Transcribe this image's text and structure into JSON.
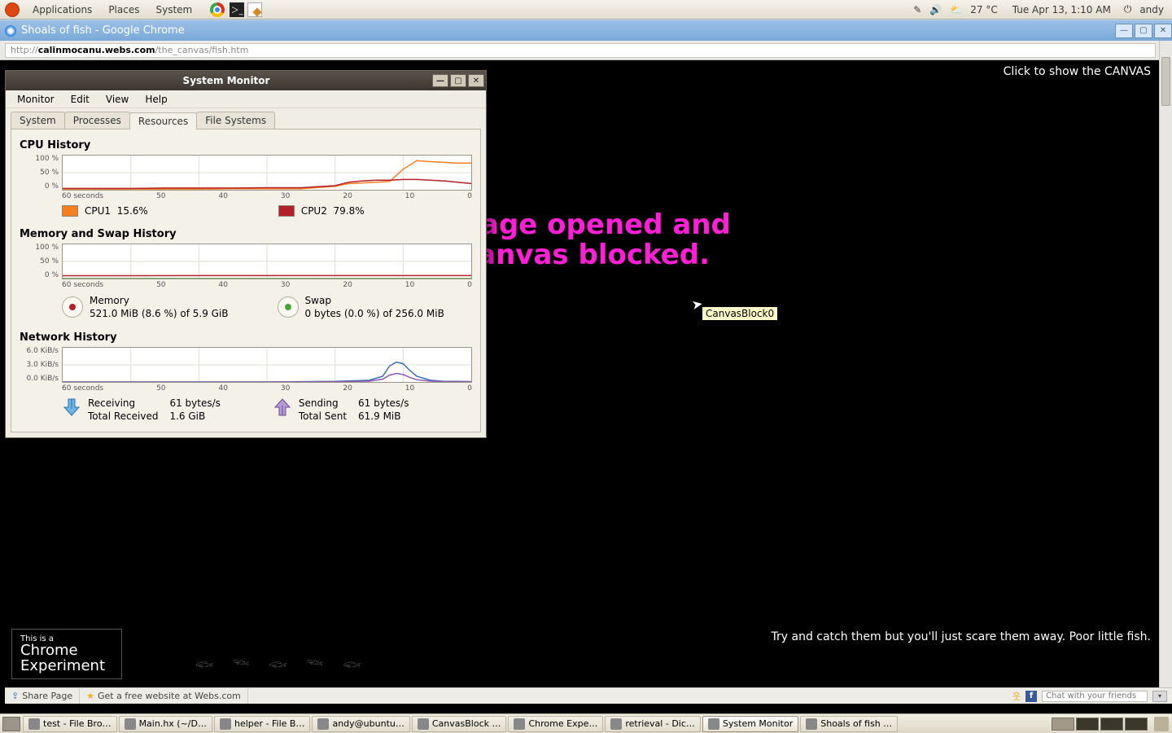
{
  "top_panel": {
    "menus": [
      "Applications",
      "Places",
      "System"
    ],
    "temp": "27 °C",
    "datetime": "Tue Apr 13,  1:10 AM",
    "user": "andy"
  },
  "chrome": {
    "title": "Shoals of fish - Google Chrome",
    "url_prefix": "http://",
    "url_host": "calinmocanu.webs.com",
    "url_path": "/the_canvas/fish.htm"
  },
  "page": {
    "top_link": "Click to show the CANVAS",
    "caption": "Try and catch them but you'll just scare them away. Poor little fish.",
    "exp_small": "This is a",
    "exp_line1": "Chrome",
    "exp_line2": "Experiment",
    "tooltip": "CanvasBlock0"
  },
  "webs_bar": {
    "share": "Share Page",
    "getsite": "Get a free website at Webs.com",
    "chat_placeholder": "Chat with your friends"
  },
  "sysmon": {
    "title": "System Monitor",
    "menus": [
      "Monitor",
      "Edit",
      "View",
      "Help"
    ],
    "tabs": [
      "System",
      "Processes",
      "Resources",
      "File Systems"
    ],
    "active_tab": 2,
    "cpu_title": "CPU History",
    "mem_title": "Memory and Swap History",
    "net_title": "Network History",
    "x_ticks": [
      "60 seconds",
      "50",
      "40",
      "30",
      "20",
      "10",
      "0"
    ],
    "cpu_y": [
      "100 %",
      "50 %",
      "0 %"
    ],
    "mem_y": [
      "100 %",
      "50 %",
      "0 %"
    ],
    "net_y": [
      "6.0 KiB/s",
      "3.0 KiB/s",
      "0.0 KiB/s"
    ],
    "cpu_legend": [
      {
        "label": "CPU1",
        "value": "15.6%",
        "color": "#f57e20"
      },
      {
        "label": "CPU2",
        "value": "79.8%",
        "color": "#b3202a"
      }
    ],
    "mem_legend": {
      "mem_label": "Memory",
      "mem_detail": "521.0 MiB (8.6 %) of 5.9 GiB",
      "swap_label": "Swap",
      "swap_detail": "0 bytes (0.0 %) of 256.0 MiB"
    },
    "net_legend": {
      "recv_label": "Receiving",
      "recv_rate": "61 bytes/s",
      "recv_total_label": "Total Received",
      "recv_total": "1.6 GiB",
      "send_label": "Sending",
      "send_rate": "61 bytes/s",
      "send_total_label": "Total Sent",
      "send_total": "61.9 MiB"
    }
  },
  "annotation": {
    "text": "Page opened and\ncanvas blocked."
  },
  "taskbar": {
    "items": [
      "test - File Bro…",
      "Main.hx (~/D…",
      "helper - File B…",
      "andy@ubuntu…",
      "CanvasBlock …",
      "Chrome Expe…",
      "retrieval - Dic…",
      "System Monitor",
      "Shoals of fish …"
    ],
    "active": 7
  },
  "chart_data": [
    {
      "type": "line",
      "title": "CPU History",
      "xlabel": "seconds ago",
      "ylabel": "%",
      "x": [
        60,
        55,
        50,
        45,
        40,
        35,
        30,
        25,
        20,
        18,
        16,
        14,
        12,
        10,
        8,
        6,
        4,
        2,
        0
      ],
      "series": [
        {
          "name": "CPU1",
          "color": "#f57e20",
          "values": [
            2,
            2,
            2,
            2,
            2,
            3,
            3,
            3,
            10,
            18,
            20,
            22,
            24,
            60,
            85,
            82,
            80,
            78,
            78
          ]
        },
        {
          "name": "CPU2",
          "color": "#b3202a",
          "values": [
            4,
            4,
            4,
            5,
            5,
            5,
            6,
            6,
            12,
            22,
            26,
            28,
            28,
            30,
            30,
            28,
            26,
            22,
            18
          ]
        }
      ],
      "ylim": [
        0,
        100
      ]
    },
    {
      "type": "line",
      "title": "Memory and Swap History",
      "xlabel": "seconds ago",
      "ylabel": "%",
      "x": [
        60,
        50,
        40,
        30,
        20,
        10,
        0
      ],
      "series": [
        {
          "name": "Memory",
          "color": "#b3202a",
          "values": [
            8.4,
            8.4,
            8.5,
            8.5,
            8.6,
            8.6,
            8.6
          ]
        },
        {
          "name": "Swap",
          "color": "#4ba33a",
          "values": [
            0,
            0,
            0,
            0,
            0,
            0,
            0
          ]
        }
      ],
      "ylim": [
        0,
        100
      ]
    },
    {
      "type": "line",
      "title": "Network History",
      "xlabel": "seconds ago",
      "ylabel": "KiB/s",
      "x": [
        60,
        50,
        40,
        30,
        20,
        15,
        13,
        12,
        11,
        10,
        9,
        8,
        6,
        4,
        2,
        0
      ],
      "series": [
        {
          "name": "Receiving",
          "color": "#3a6fb7",
          "values": [
            0,
            0,
            0,
            0,
            0.1,
            0.3,
            1.0,
            2.8,
            3.5,
            3.2,
            2.0,
            1.0,
            0.3,
            0.1,
            0.1,
            0.06
          ]
        },
        {
          "name": "Sending",
          "color": "#8a5bb0",
          "values": [
            0,
            0,
            0,
            0,
            0.05,
            0.15,
            0.5,
            1.2,
            1.5,
            1.3,
            0.8,
            0.4,
            0.15,
            0.06,
            0.06,
            0.06
          ]
        }
      ],
      "ylim": [
        0,
        6
      ]
    }
  ]
}
